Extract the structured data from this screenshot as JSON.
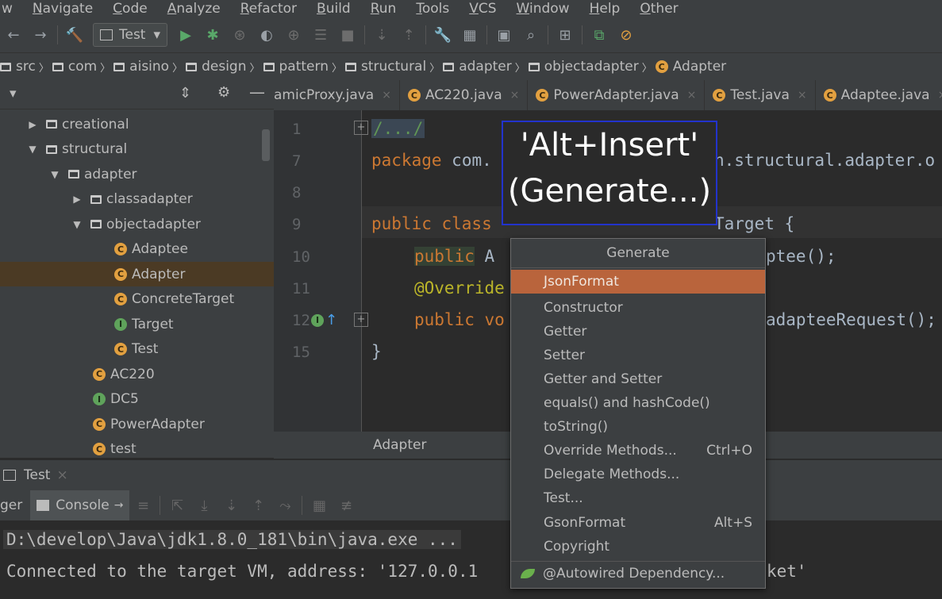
{
  "menu": [
    "w",
    "Navigate",
    "Code",
    "Analyze",
    "Refactor",
    "Build",
    "Run",
    "Tools",
    "VCS",
    "Window",
    "Help",
    "Other"
  ],
  "toolbar": {
    "run_config": "Test",
    "chevron": "▾"
  },
  "breadcrumb": [
    "src",
    "com",
    "aisino",
    "design",
    "pattern",
    "structural",
    "adapter",
    "objectadapter",
    "Adapter"
  ],
  "tree": {
    "header_caret": "▾",
    "items": [
      {
        "label": "creational",
        "type": "folder",
        "depth": 1,
        "expanded": false
      },
      {
        "label": "structural",
        "type": "folder",
        "depth": 1,
        "expanded": true
      },
      {
        "label": "adapter",
        "type": "folder",
        "depth": 2,
        "expanded": true
      },
      {
        "label": "classadapter",
        "type": "folder",
        "depth": 3,
        "expanded": false
      },
      {
        "label": "objectadapter",
        "type": "folder",
        "depth": 3,
        "expanded": true
      },
      {
        "label": "Adaptee",
        "type": "class",
        "depth": 4
      },
      {
        "label": "Adapter",
        "type": "class",
        "depth": 4,
        "selected": true
      },
      {
        "label": "ConcreteTarget",
        "type": "class",
        "depth": 4
      },
      {
        "label": "Target",
        "type": "interface",
        "depth": 4
      },
      {
        "label": "Test",
        "type": "class",
        "depth": 4
      },
      {
        "label": "AC220",
        "type": "class",
        "depth": 3
      },
      {
        "label": "DC5",
        "type": "interface",
        "depth": 3
      },
      {
        "label": "PowerAdapter",
        "type": "class",
        "depth": 3
      },
      {
        "label": "test",
        "type": "class",
        "depth": 3
      }
    ]
  },
  "tabs": [
    "amicProxy.java",
    "AC220.java",
    "PowerAdapter.java",
    "Test.java",
    "Adaptee.java"
  ],
  "editor": {
    "line_numbers": [
      "1",
      "7",
      "8",
      "9",
      "10",
      "11",
      "12",
      "15"
    ],
    "line1": "/.../",
    "line7_kw": "package",
    "line7_a": "com.",
    "line7_b": "n.structural.adapter.o",
    "line9_kw": "public class",
    "line9_b": "Target {",
    "line10_kw": "public",
    "line10_a": "A",
    "line10_b": "ptee();",
    "line11": "@Override",
    "line12_kw": "public vo",
    "line12_b": "adapteeRequest();",
    "line15": "}",
    "status_class": "Adapter",
    "gutter_badge": "I"
  },
  "overlay": {
    "line1": "'Alt+Insert'",
    "line2": "(Generate...)"
  },
  "popup": {
    "title": "Generate",
    "items": [
      {
        "label": "JsonFormat",
        "shortcut": "",
        "selected": true
      },
      {
        "label": "Constructor",
        "shortcut": ""
      },
      {
        "label": "Getter",
        "shortcut": ""
      },
      {
        "label": "Setter",
        "shortcut": ""
      },
      {
        "label": "Getter and Setter",
        "shortcut": ""
      },
      {
        "label": "equals() and hashCode()",
        "shortcut": ""
      },
      {
        "label": "toString()",
        "shortcut": ""
      },
      {
        "label": "Override Methods...",
        "shortcut": "Ctrl+O"
      },
      {
        "label": "Delegate Methods...",
        "shortcut": ""
      },
      {
        "label": "Test...",
        "shortcut": ""
      },
      {
        "label": "GsonFormat",
        "shortcut": "Alt+S"
      },
      {
        "label": "Copyright",
        "shortcut": ""
      },
      {
        "label": "@Autowired Dependency...",
        "shortcut": ""
      }
    ]
  },
  "run_panel": {
    "tab": "Test",
    "left_tab": "ger",
    "console_tab": "Console"
  },
  "console": {
    "line1": "D:\\develop\\Java\\jdk1.8.0_181\\bin\\java.exe ...",
    "line2a": "Connected to the target VM, address: '127.0.0.1",
    "line2b": "ket'"
  }
}
